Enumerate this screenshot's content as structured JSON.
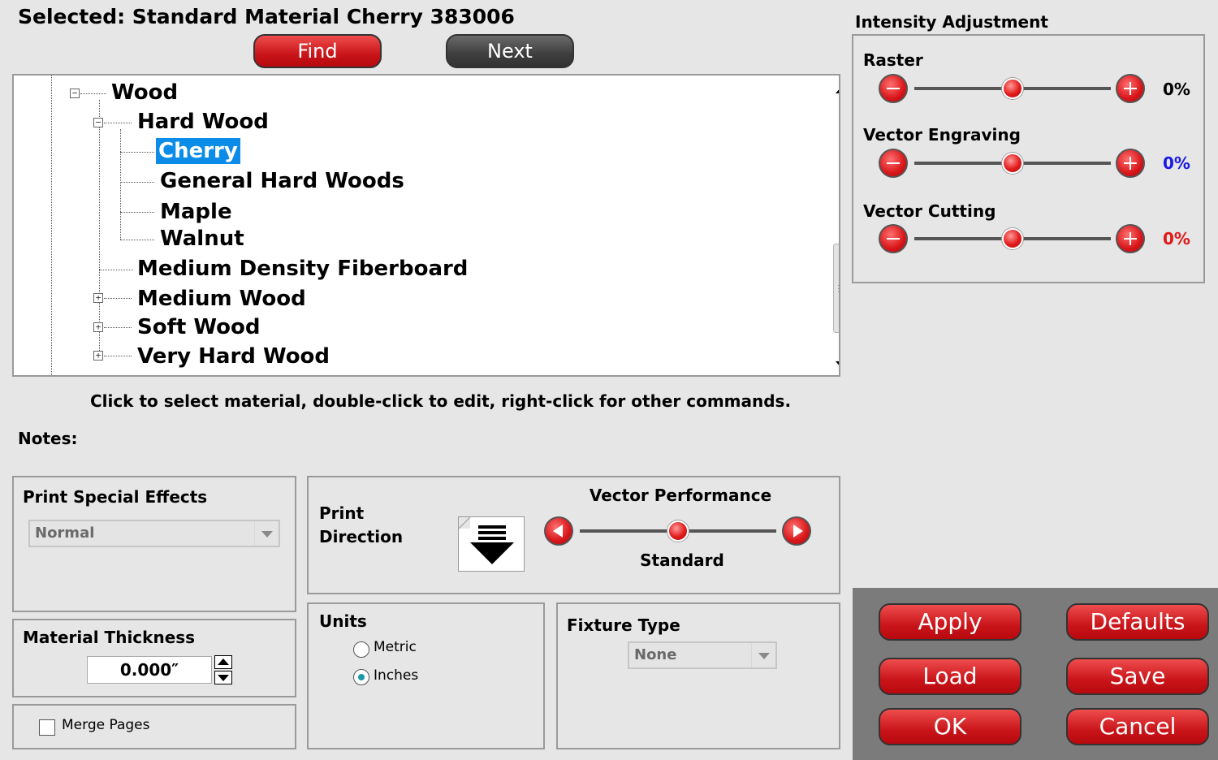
{
  "header": {
    "selected_text": "Selected: Standard Material Cherry 383006",
    "find_label": "Find",
    "next_label": "Next"
  },
  "tree": {
    "items": [
      {
        "label": "Wood",
        "expanded": true
      },
      {
        "label": "Hard Wood",
        "expanded": true
      },
      {
        "label": "Cherry",
        "selected": true
      },
      {
        "label": "General Hard Woods"
      },
      {
        "label": "Maple"
      },
      {
        "label": "Walnut"
      },
      {
        "label": "Medium Density Fiberboard"
      },
      {
        "label": "Medium Wood",
        "expanded": false
      },
      {
        "label": "Soft Wood",
        "expanded": false
      },
      {
        "label": "Very Hard Wood",
        "expanded": false
      }
    ],
    "selection_color": "#0a8ce8"
  },
  "help_text": "Click to select material, double-click to edit, right-click for other commands.",
  "notes_label": "Notes:",
  "print_effects": {
    "title": "Print Special Effects",
    "value": "Normal"
  },
  "thickness": {
    "title": "Material Thickness",
    "value": "0.000″"
  },
  "merge_pages": {
    "label": "Merge Pages",
    "checked": false
  },
  "print_direction": {
    "title": "Print Direction",
    "title_line1": "Print",
    "title_line2": "Direction",
    "icon": "down-arrow-icon"
  },
  "vector_performance": {
    "title": "Vector Performance",
    "value_label": "Standard",
    "level": 0.5
  },
  "units": {
    "title": "Units",
    "options": [
      "Metric",
      "Inches"
    ],
    "selected": "Inches"
  },
  "fixture": {
    "title": "Fixture Type",
    "value": "None"
  },
  "intensity": {
    "title": "Intensity Adjustment",
    "sliders": [
      {
        "label": "Raster",
        "value": "0%",
        "level": 0.5,
        "color": "#000000"
      },
      {
        "label": "Vector Engraving",
        "value": "0%",
        "level": 0.5,
        "color": "#1a1ae6"
      },
      {
        "label": "Vector Cutting",
        "value": "0%",
        "level": 0.5,
        "color": "#e01818"
      }
    ]
  },
  "actions": {
    "apply": "Apply",
    "defaults": "Defaults",
    "load": "Load",
    "save": "Save",
    "ok": "OK",
    "cancel": "Cancel"
  },
  "colors": {
    "button_red": "#d1161b",
    "button_gray": "#4a4a4a",
    "background": "#e6e6e6",
    "action_panel": "#7b7b7b"
  }
}
